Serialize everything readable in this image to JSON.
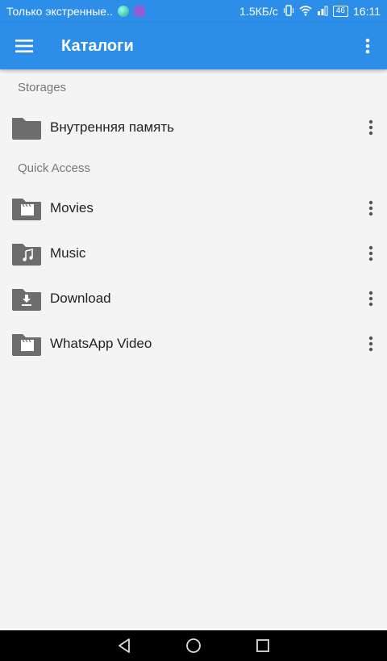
{
  "status_bar": {
    "notification_text": "Только экстренные..",
    "network_speed": "1.5КБ/с",
    "battery_level": "46",
    "time": "16:11"
  },
  "app_bar": {
    "title": "Каталоги",
    "menu_icon": "hamburger-menu-icon",
    "overflow_icon": "more-vert-icon"
  },
  "sections": {
    "storages": {
      "header": "Storages",
      "items": [
        {
          "label": "Внутренняя память",
          "icon": "folder-icon"
        }
      ]
    },
    "quick_access": {
      "header": "Quick Access",
      "items": [
        {
          "label": "Movies",
          "icon": "movie-folder-icon"
        },
        {
          "label": "Music",
          "icon": "music-folder-icon"
        },
        {
          "label": "Download",
          "icon": "download-folder-icon"
        },
        {
          "label": "WhatsApp Video",
          "icon": "movie-folder-icon"
        }
      ]
    }
  },
  "colors": {
    "primary": "#2c8ee8",
    "background": "#f4f4f4",
    "icon_gray": "#6d6d6d",
    "text": "#222222",
    "section_header": "#777777"
  }
}
